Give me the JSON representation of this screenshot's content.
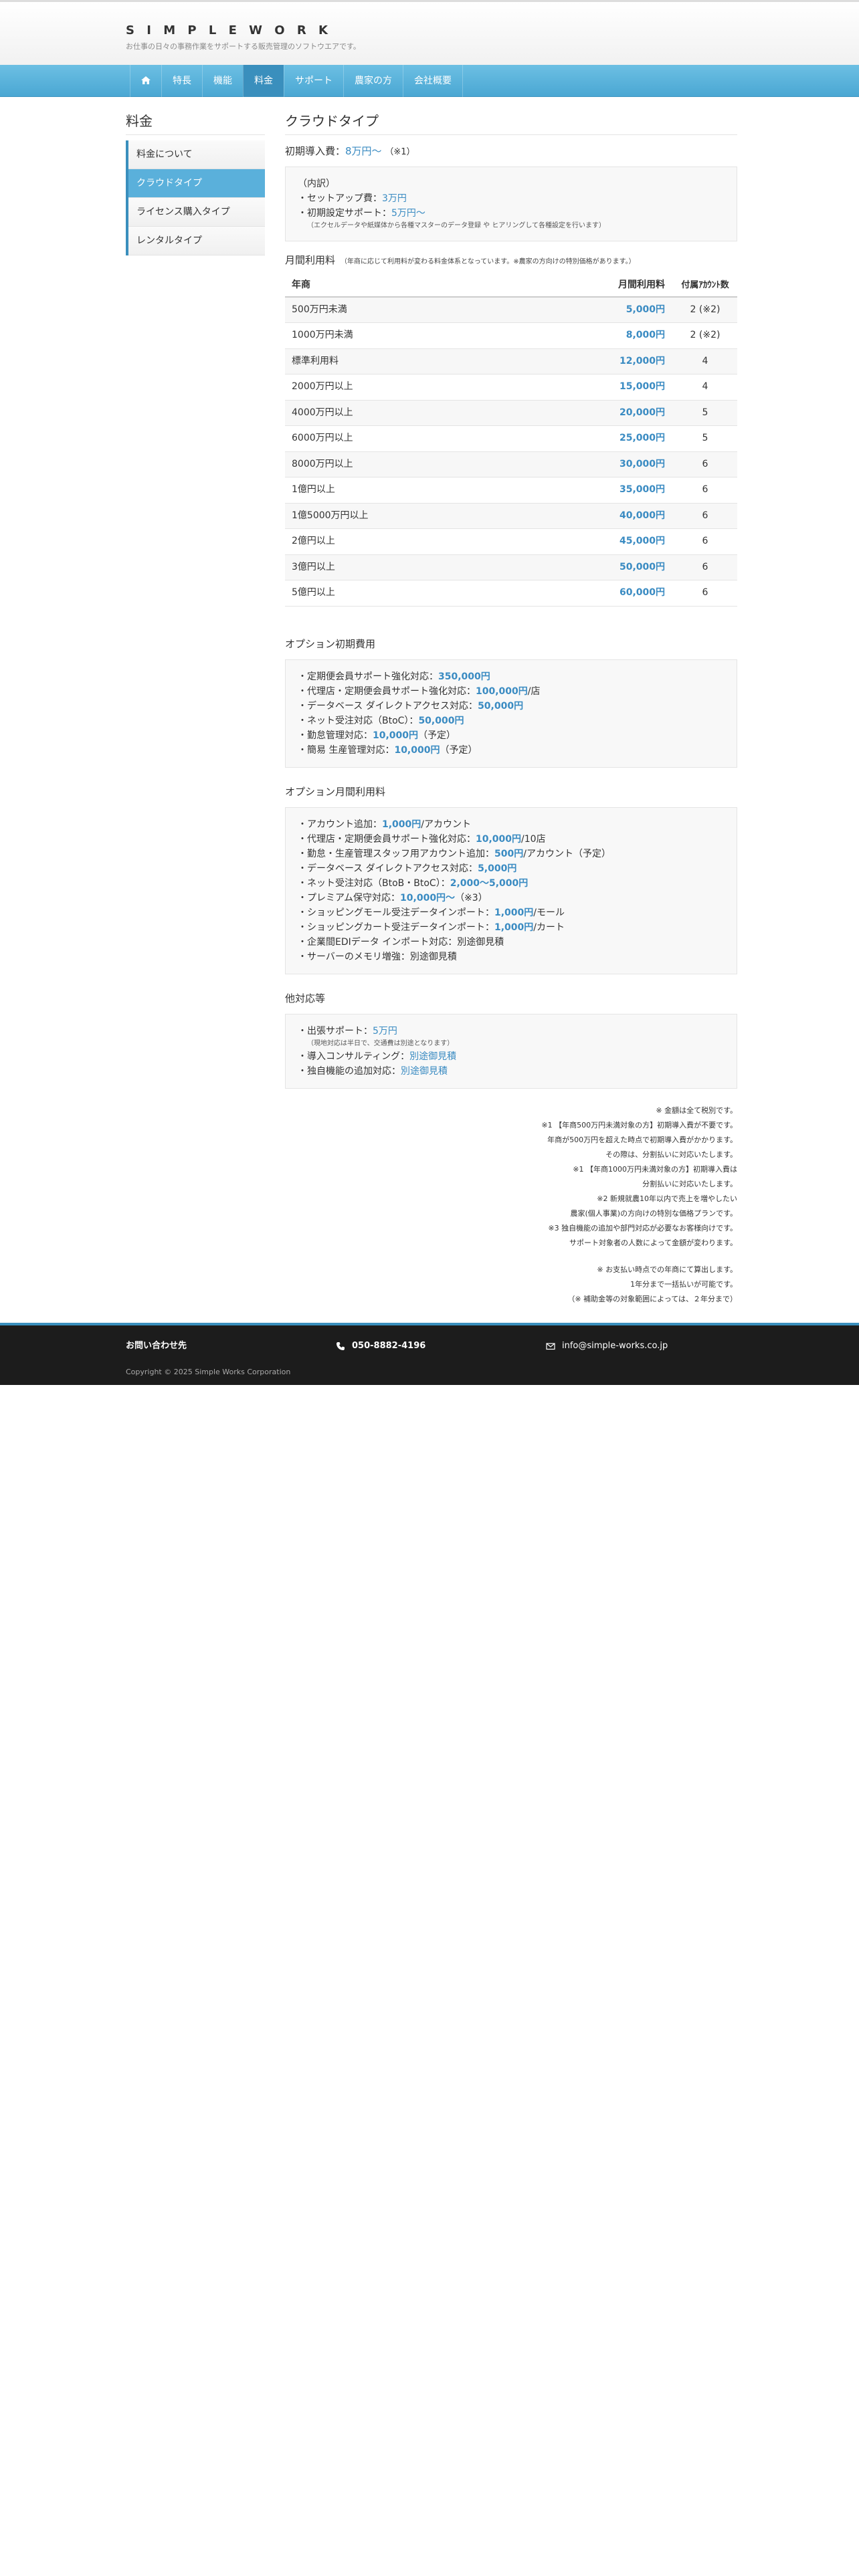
{
  "site": {
    "logo": "S  I  M  P  L  E   W  O  R  K",
    "tagline": "お仕事の日々の事務作業をサポートする販売管理のソフトウエアです。"
  },
  "nav": [
    {
      "label": "",
      "icon": "home-icon"
    },
    {
      "label": "特長"
    },
    {
      "label": "機能"
    },
    {
      "label": "料金",
      "active": true
    },
    {
      "label": "サポート"
    },
    {
      "label": "農家の方"
    },
    {
      "label": "会社概要"
    }
  ],
  "sidebar": {
    "title": "料金",
    "items": [
      {
        "label": "料金について"
      },
      {
        "label": "クラウドタイプ",
        "active": true
      },
      {
        "label": "ライセンス購入タイプ"
      },
      {
        "label": "レンタルタイプ"
      }
    ]
  },
  "main": {
    "title": "クラウドタイプ",
    "initial": {
      "label": "初期導入費：",
      "price": "8万円〜",
      "note": "（※1）",
      "breakdown_title": "（内訳）",
      "setup_label": "・セットアップ費：",
      "setup_price": "3万円",
      "support_label": "・初期設定サポート：",
      "support_price": "5万円〜",
      "support_note": "（エクセルデータや紙媒体から各種マスターのデータ登録 や ヒアリングして各種設定を行います）"
    },
    "monthly": {
      "title": "月間利用料",
      "note": "（年商に応じて利用料が変わる料金体系となっています。※農家の方向けの特別価格があります。）",
      "headers": [
        "年商",
        "月間利用料",
        "付属ｱｶｳﾝﾄ数"
      ],
      "rows": [
        {
          "tier": "500万円未満",
          "price": "5,000円",
          "accounts": "2 (※2)"
        },
        {
          "tier": "1000万円未満",
          "price": "8,000円",
          "accounts": "2 (※2)"
        },
        {
          "tier": "標準利用料",
          "price": "12,000円",
          "accounts": "4"
        },
        {
          "tier": "2000万円以上",
          "price": "15,000円",
          "accounts": "4"
        },
        {
          "tier": "4000万円以上",
          "price": "20,000円",
          "accounts": "5"
        },
        {
          "tier": "6000万円以上",
          "price": "25,000円",
          "accounts": "5"
        },
        {
          "tier": "8000万円以上",
          "price": "30,000円",
          "accounts": "6"
        },
        {
          "tier": "1億円以上",
          "price": "35,000円",
          "accounts": "6"
        },
        {
          "tier": "1億5000万円以上",
          "price": "40,000円",
          "accounts": "6"
        },
        {
          "tier": "2億円以上",
          "price": "45,000円",
          "accounts": "6"
        },
        {
          "tier": "3億円以上",
          "price": "50,000円",
          "accounts": "6"
        },
        {
          "tier": "5億円以上",
          "price": "60,000円",
          "accounts": "6"
        }
      ]
    },
    "option_initial": {
      "title": "オプション初期費用",
      "items": [
        {
          "label": "・定期便会員サポート強化対応：",
          "price": "350,000円",
          "suffix": ""
        },
        {
          "label": "・代理店・定期便会員サポート強化対応：",
          "price": "100,000円",
          "suffix": "/店"
        },
        {
          "label": "・データベース ダイレクトアクセス対応：",
          "price": "50,000円",
          "suffix": ""
        },
        {
          "label": "・ネット受注対応（BtoC）：",
          "price": "50,000円",
          "suffix": ""
        },
        {
          "label": "・勤怠管理対応：",
          "price": "10,000円",
          "suffix": "（予定）"
        },
        {
          "label": "・簡易 生産管理対応：",
          "price": "10,000円",
          "suffix": "（予定）"
        }
      ]
    },
    "option_monthly": {
      "title": "オプション月間利用料",
      "items": [
        {
          "label": "・アカウント追加：",
          "price": "1,000円",
          "suffix": "/アカウント"
        },
        {
          "label": "・代理店・定期便会員サポート強化対応：",
          "price": "10,000円",
          "suffix": "/10店"
        },
        {
          "label": "・勤怠・生産管理スタッフ用アカウント追加：",
          "price": "500円",
          "suffix": "/アカウント（予定）"
        },
        {
          "label": "・データベース ダイレクトアクセス対応：",
          "price": "5,000円",
          "suffix": ""
        },
        {
          "label": "・ネット受注対応（BtoB・BtoC）：",
          "price": "2,000〜5,000円",
          "suffix": ""
        },
        {
          "label": "・プレミアム保守対応：",
          "price": "10,000円〜",
          "suffix": "（※3）"
        },
        {
          "label": "・ショッピングモール受注データインポート：",
          "price": "1,000円",
          "suffix": "/モール"
        },
        {
          "label": "・ショッピングカート受注データインポート：",
          "price": "1,000円",
          "suffix": "/カート"
        },
        {
          "label": "・企業間EDIデータ インポート対応：別途御見積",
          "price": "",
          "suffix": ""
        },
        {
          "label": "・サーバーのメモリ増強：別途御見積",
          "price": "",
          "suffix": ""
        }
      ]
    },
    "other": {
      "title": "他対応等",
      "visit_label": "・出張サポート：",
      "visit_price": "5万円",
      "visit_note": "（現地対応は半日で、交通費は別途となります）",
      "consult_label": "・導入コンサルティング：",
      "consult_price": "別途御見積",
      "custom_label": "・独自機能の追加対応：",
      "custom_price": "別途御見積"
    },
    "notes": [
      "※ 金額は全て税別です。",
      "※1 【年商500万円未満対象の方】初期導入費が不要です。",
      "年商が500万円を超えた時点で初期導入費がかかります。",
      "その際は、分割払いに対応いたします。",
      "※1 【年商1000万円未満対象の方】初期導入費は",
      "分割払いに対応いたします。",
      "※2 新規就農10年以内で売上を増やしたい",
      "農家(個人事業)の方向けの特別な価格プランです。",
      "※3 独自機能の追加や部門対応が必要なお客様向けです。",
      "サポート対象者の人数によって金額が変わります。",
      "",
      "※ お支払い時点での年商にて算出します。",
      "1年分まで一括払いが可能です。",
      "（※ 補助金等の対象範囲によっては、２年分まで）"
    ]
  },
  "footer": {
    "contact_label": "お問い合わせ先",
    "phone": "050-8882-4196",
    "email": "info@simple-works.co.jp",
    "copyright": "Copyright © 2025 Simple Works Corporation"
  },
  "colors": {
    "accent": "#3a8bc2",
    "nav": "#4aa7d3",
    "footer": "#1c1c1c"
  }
}
